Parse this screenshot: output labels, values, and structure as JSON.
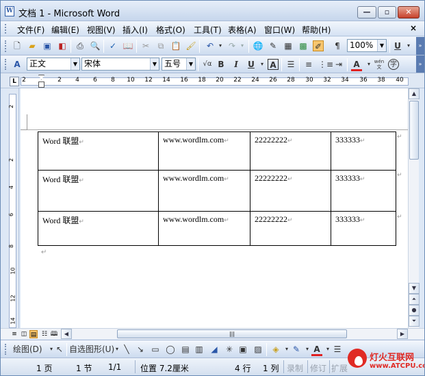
{
  "window": {
    "title": "文档 1 - Microsoft Word",
    "app_icon": "W",
    "min": "—",
    "max": "▫",
    "close": "✕"
  },
  "menu": {
    "items": [
      "文件(F)",
      "编辑(E)",
      "视图(V)",
      "插入(I)",
      "格式(O)",
      "工具(T)",
      "表格(A)",
      "窗口(W)",
      "帮助(H)"
    ],
    "close": "×"
  },
  "toolbar": {
    "zoom": "100%",
    "underline_label": "U"
  },
  "format_bar": {
    "style": "正文",
    "font": "宋体",
    "size": "五号",
    "bold": "B",
    "italic": "I",
    "underline": "U",
    "box": "A",
    "font_color_label": "A",
    "phonetic": "wén 文",
    "enclose": "字"
  },
  "ruler": {
    "h_marks": [
      "2",
      "2",
      "4",
      "6",
      "8",
      "10",
      "12",
      "14",
      "16",
      "18",
      "20",
      "22",
      "24",
      "26",
      "28",
      "30",
      "32",
      "34",
      "36",
      "38",
      "40"
    ],
    "v_marks": [
      "2",
      "2",
      "4",
      "6",
      "8",
      "10",
      "12",
      "14"
    ]
  },
  "table": {
    "rows": [
      [
        "Word 联盟",
        "www.wordlm.com",
        "22222222",
        "333333"
      ],
      [
        "Word 联盟",
        "www.wordlm.com",
        "22222222",
        "333333"
      ],
      [
        "Word 联盟",
        "www.wordlm.com",
        "22222222",
        "333333"
      ]
    ],
    "cell_mark": "↵"
  },
  "draw_bar": {
    "draw": "绘图(D)",
    "autoshapes": "自选图形(U)"
  },
  "status": {
    "page": "1 页",
    "section": "1 节",
    "pages": "1/1",
    "position": "位置 7.2厘米",
    "line": "4 行",
    "col": "1 列",
    "rec": "录制",
    "trk": "修订",
    "ext": "扩展"
  },
  "watermark": {
    "name": "灯火互联网",
    "url": "www.ATCPU.com"
  },
  "colors": {
    "title_gradient_top": "#e6eef9",
    "toolbar": "#ccdbef",
    "close_red": "#c6402b",
    "logo_red": "#e02a24"
  }
}
